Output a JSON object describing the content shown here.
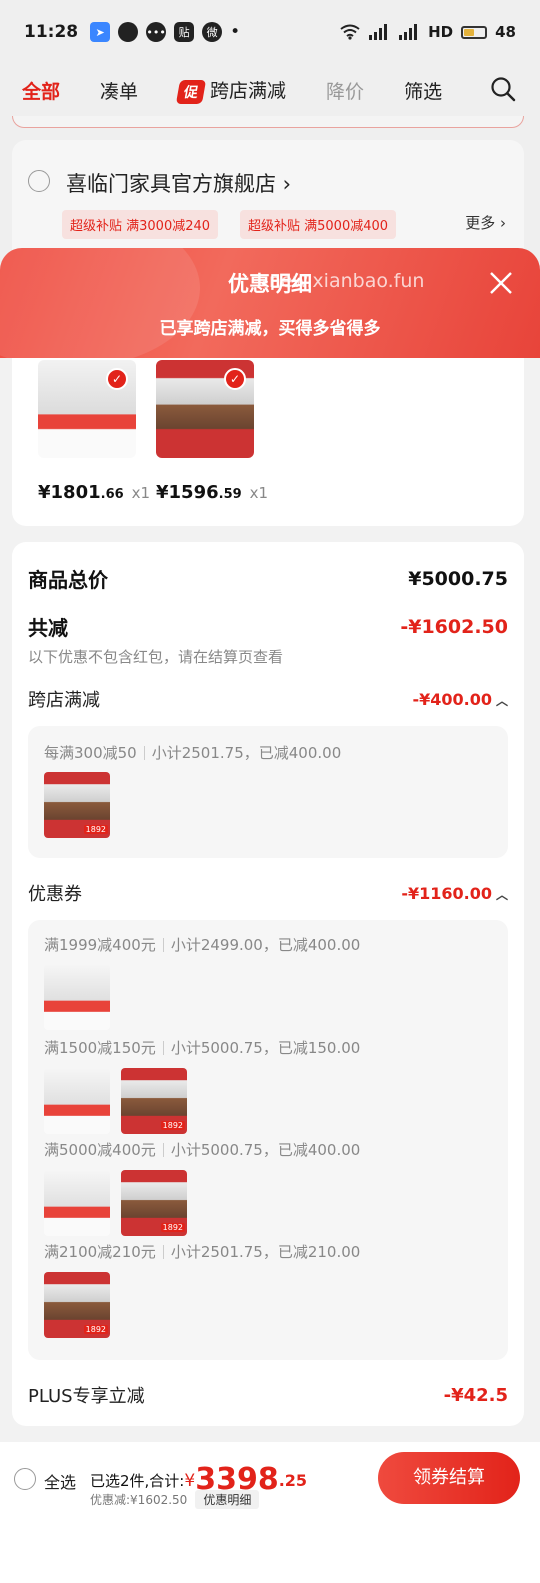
{
  "status_bar": {
    "time": "11:28",
    "network": "HD",
    "battery": "48"
  },
  "filter_tabs": [
    {
      "label": "全部",
      "state": "active"
    },
    {
      "label": "凑单",
      "state": "normal"
    },
    {
      "label": "跨店满减",
      "badge": "促",
      "state": "normal"
    },
    {
      "label": "降价",
      "state": "dim"
    },
    {
      "label": "筛选",
      "state": "normal"
    }
  ],
  "shop": {
    "name": "喜临门家具官方旗舰店",
    "chips": [
      "超级补贴 满3000减240",
      "超级补贴 满5000减400"
    ],
    "more": "更多"
  },
  "sheet": {
    "title": "优惠明细",
    "watermark": "-new.xianbao.fun",
    "subtitle": "已享跨店满减，买得多省得多"
  },
  "products": [
    {
      "price_int": "¥1801",
      "price_dec": ".66",
      "qty": "x1",
      "kind": "mattress"
    },
    {
      "price_int": "¥1596",
      "price_dec": ".59",
      "qty": "x1",
      "kind": "table"
    }
  ],
  "summary": {
    "total_label": "商品总价",
    "total_value": "¥5000.75",
    "reduce_label": "共减",
    "reduce_value": "-¥1602.50",
    "note": "以下优惠不包含红包，请在结算页查看"
  },
  "cross_store": {
    "label": "跨店满减",
    "value": "-¥400.00",
    "rule_a": "每满300减50",
    "rule_b": "小计2501.75，已减400.00"
  },
  "coupons": {
    "label": "优惠券",
    "value": "-¥1160.00",
    "items": [
      {
        "rule_a": "满1999减400元",
        "rule_b": "小计2499.00，已减400.00"
      },
      {
        "rule_a": "满1500减150元",
        "rule_b": "小计5000.75，已减150.00"
      },
      {
        "rule_a": "满5000减400元",
        "rule_b": "小计5000.75，已减400.00"
      },
      {
        "rule_a": "满2100减210元",
        "rule_b": "小计2501.75，已减210.00"
      }
    ]
  },
  "plus": {
    "label": "PLUS专享立减",
    "value": "-¥42.5"
  },
  "thumb_tag": "1892",
  "bottom": {
    "select_all": "全选",
    "selected_text": "已选2件,合计:",
    "yen": "¥",
    "amount_int": "3398",
    "amount_dec": ".25",
    "discount_text": "优惠减:¥1602.50",
    "detail_link": "优惠明细",
    "checkout": "领券结算"
  },
  "colors": {
    "accent": "#e2231a",
    "header_gradient_start": "#ef4a3e",
    "header_gradient_end": "#e8443a"
  },
  "icons": [
    "navigation-icon",
    "wifi-icon",
    "signal-icon",
    "battery-icon",
    "search-icon",
    "close-icon",
    "chevron-up-icon",
    "check-icon"
  ]
}
